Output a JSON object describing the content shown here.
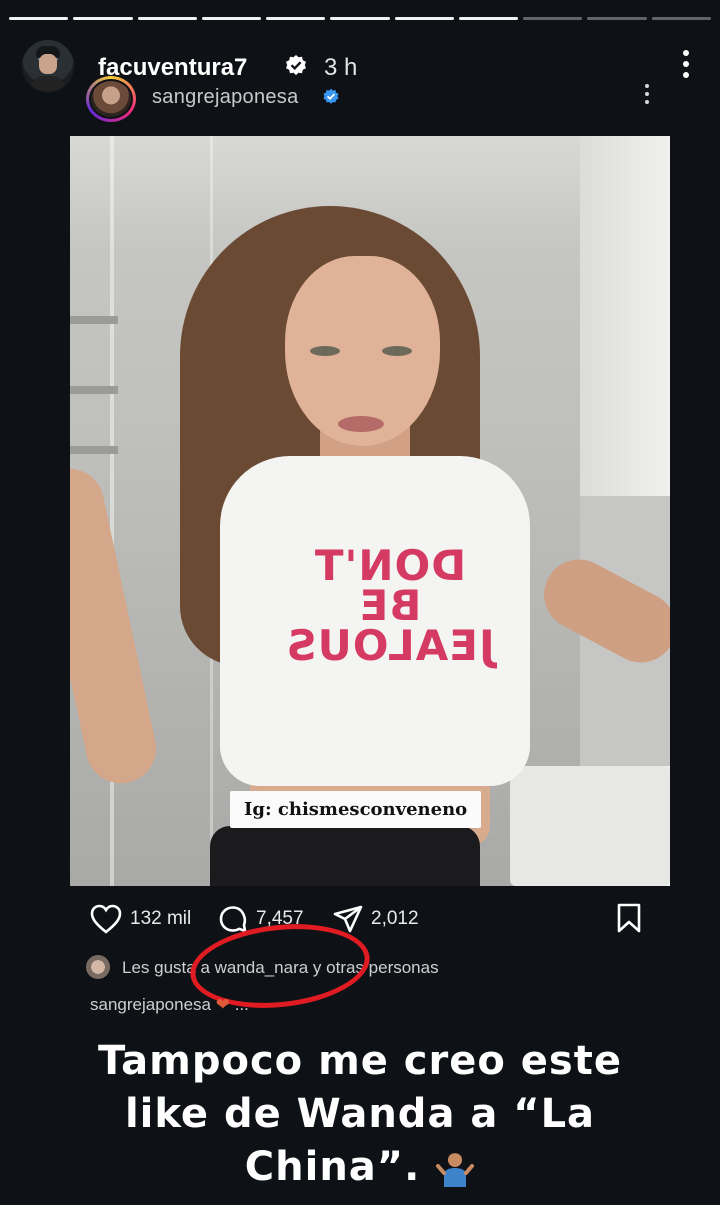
{
  "story": {
    "username": "facuventura7",
    "time": "3 h",
    "progress_segments": 11,
    "progress_current": 8
  },
  "post": {
    "username": "sangrejaponesa",
    "shirt_text": "DON'T BE\nJEALOUS",
    "watermark": "Ig: chismesconveneno",
    "likes_count": "132 mil",
    "comments_count": "7,457",
    "shares_count": "2,012",
    "liked_by_text": "Les gusta a wanda_nara y otras personas",
    "caption_user": "sangrejaponesa",
    "caption_tail": "..."
  },
  "overlay": {
    "line1": "Tampoco me creo este",
    "line2": "like de Wanda a “La",
    "line3": "China”."
  },
  "colors": {
    "background": "#0e1116",
    "annotation_circle": "#e01c22",
    "verified": "#3897f0",
    "shirt_print": "#d43a62"
  },
  "icons": [
    "verified-badge-icon",
    "more-options-icon",
    "heart-icon",
    "comment-icon",
    "share-icon",
    "bookmark-icon",
    "shrug-emoji-icon"
  ]
}
